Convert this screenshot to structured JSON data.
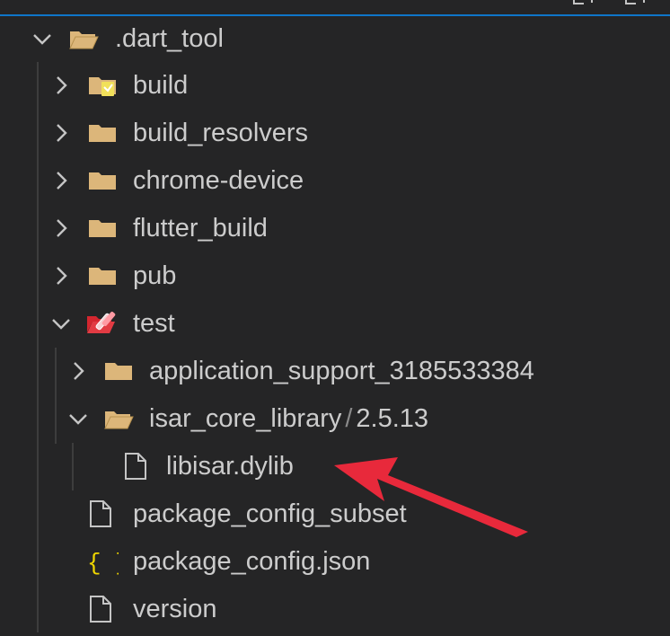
{
  "explorer": {
    "root": {
      "label": ".dart_tool",
      "expanded": true
    },
    "items": [
      {
        "label": "build",
        "type": "folder",
        "expanded": false
      },
      {
        "label": "build_resolvers",
        "type": "folder",
        "expanded": false
      },
      {
        "label": "chrome-device",
        "type": "folder",
        "expanded": false
      },
      {
        "label": "flutter_build",
        "type": "folder",
        "expanded": false
      },
      {
        "label": "pub",
        "type": "folder",
        "expanded": false
      },
      {
        "label": "test",
        "type": "folder",
        "expanded": true
      }
    ],
    "test_children": [
      {
        "label": "application_support_3185533384",
        "type": "folder",
        "expanded": false
      },
      {
        "label": "isar_core_library",
        "separator": "/",
        "sub": "2.5.13",
        "type": "folder",
        "expanded": true
      }
    ],
    "isar_children": [
      {
        "label": "libisar.dylib",
        "type": "file"
      }
    ],
    "files": [
      {
        "label": "package_config_subset",
        "type": "file"
      },
      {
        "label": "package_config.json",
        "type": "json"
      },
      {
        "label": "version",
        "type": "file"
      }
    ]
  },
  "colors": {
    "background": "#252526",
    "folder": "#dcb67a",
    "accent_line": "#0f76c9",
    "arrow": "#e8293b",
    "json_icon": "#f1d700"
  }
}
